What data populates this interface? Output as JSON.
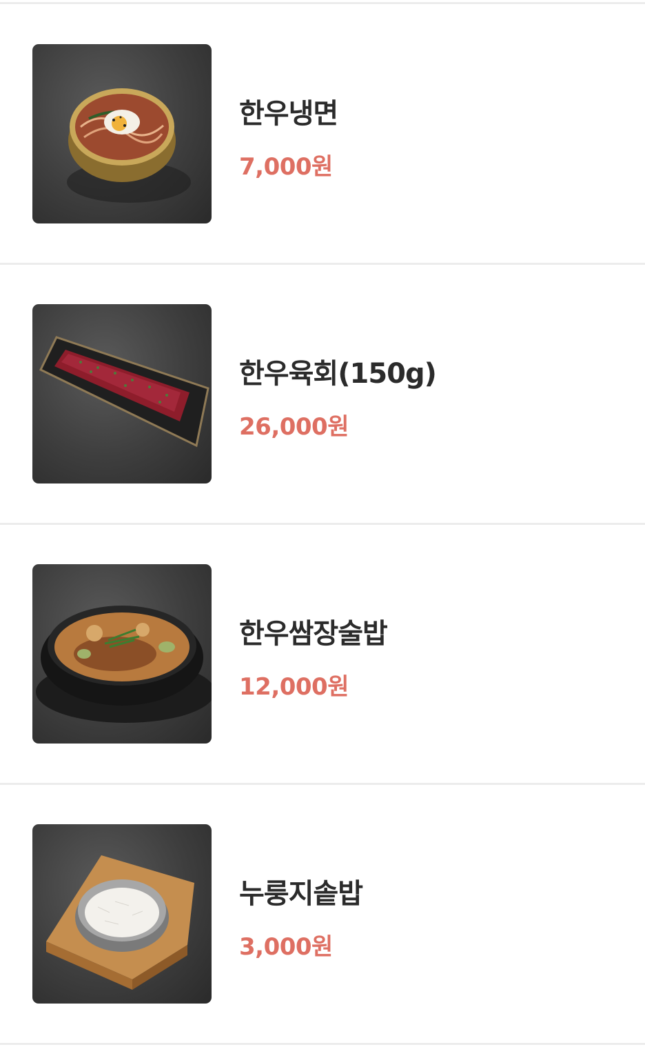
{
  "menu": {
    "items": [
      {
        "name": "한우냉면",
        "price": "7,000원",
        "photo": "naengmyeon-photo"
      },
      {
        "name": "한우육회(150g)",
        "price": "26,000원",
        "photo": "yukhoe-photo"
      },
      {
        "name": "한우쌈장술밥",
        "price": "12,000원",
        "photo": "ssamjang-sulbap-photo"
      },
      {
        "name": "누룽지솥밥",
        "price": "3,000원",
        "photo": "nurungji-sotbap-photo"
      }
    ]
  },
  "colors": {
    "price": "#de6f62",
    "name": "#2b2b2b",
    "divider": "#ececec",
    "photo_background": "#3e3e3e"
  }
}
